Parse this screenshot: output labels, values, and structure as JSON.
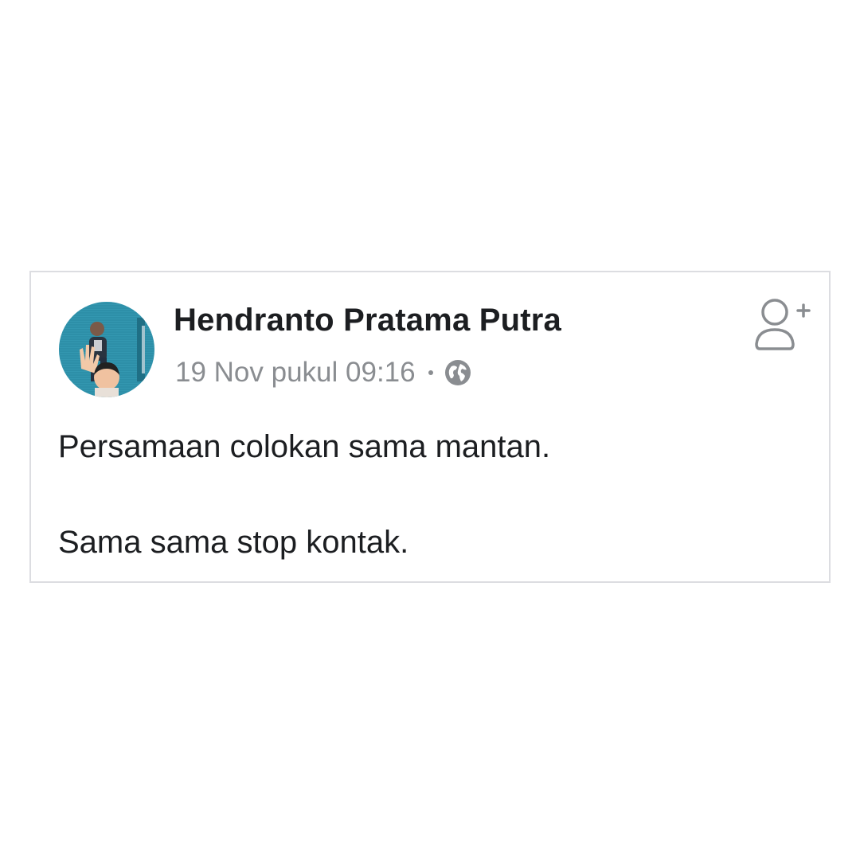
{
  "post": {
    "author": "Hendranto Pratama Putra",
    "timestamp": "19 Nov pukul 09:16",
    "separator": "•",
    "privacy_icon": "globe-icon",
    "action_icon": "add-friend-icon",
    "lines": [
      "Persamaan colokan sama mantan.",
      "Sama sama stop kontak."
    ]
  },
  "colors": {
    "name_text": "#1c1e21",
    "meta_text": "#8a8d91",
    "card_border": "#dcdde1",
    "avatar_background": "#2d8fa8"
  }
}
